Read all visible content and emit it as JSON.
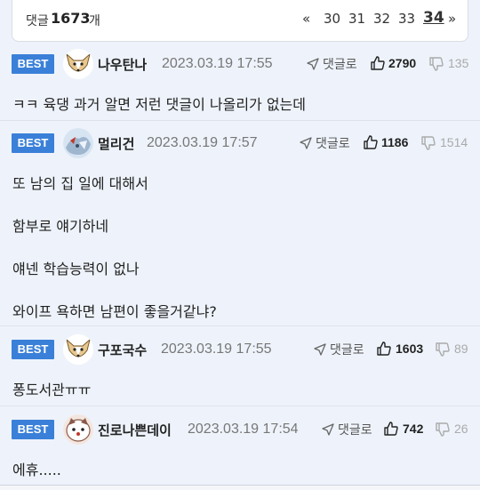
{
  "header": {
    "comment_label": "댓글",
    "comment_count": "1673",
    "comment_unit": "개",
    "prev": "«",
    "pages": [
      "30",
      "31",
      "32",
      "33"
    ],
    "current_page": "34",
    "next": "»"
  },
  "comments": [
    {
      "badge": "BEST",
      "nick": "나우탄나",
      "date": "2023.03.19 17:55",
      "reply_label": "댓글로",
      "up": "2790",
      "down": "135",
      "lines": [
        "ㅋㅋ 육댕 과거 알면 저런 댓글이 나올리가 없는데"
      ]
    },
    {
      "badge": "BEST",
      "nick": "멀리건",
      "date": "2023.03.19 17:57",
      "reply_label": "댓글로",
      "up": "1186",
      "down": "1514",
      "lines": [
        "또 남의 집 일에 대해서",
        "함부로 얘기하네",
        "얘넨 학습능력이 없나",
        "와이프 욕하면 남편이 좋을거같냐?"
      ]
    },
    {
      "badge": "BEST",
      "nick": "구포국수",
      "date": "2023.03.19 17:55",
      "reply_label": "댓글로",
      "up": "1603",
      "down": "89",
      "lines": [
        "퐁도서관ㅠㅠ"
      ]
    },
    {
      "badge": "BEST",
      "nick": "진로나쁜데이",
      "date": "2023.03.19 17:54",
      "reply_label": "댓글로",
      "up": "742",
      "down": "26",
      "lines": [
        "에휴....."
      ]
    }
  ],
  "icons": {
    "reply": "send-icon",
    "up": "thumbs-up-icon",
    "down": "thumbs-down-icon"
  },
  "colors": {
    "badge": "#3a80d8",
    "background": "#eef3fb"
  }
}
